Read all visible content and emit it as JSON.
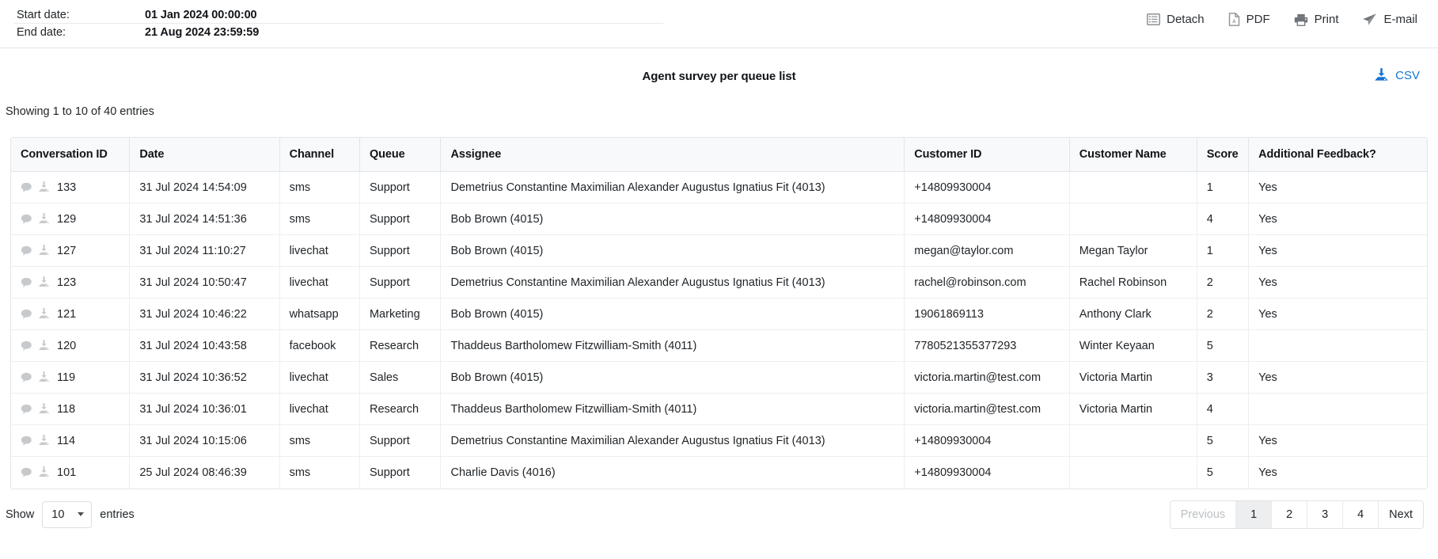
{
  "header": {
    "start_date_label": "Start date:",
    "start_date_value": "01 Jan 2024 00:00:00",
    "end_date_label": "End date:",
    "end_date_value": "21 Aug 2024 23:59:59",
    "toolbar": [
      {
        "label": "Detach",
        "icon": "detach-list-icon"
      },
      {
        "label": "PDF",
        "icon": "pdf-document-icon"
      },
      {
        "label": "Print",
        "icon": "printer-icon"
      },
      {
        "label": "E-mail",
        "icon": "paper-plane-icon"
      }
    ]
  },
  "report": {
    "title": "Agent survey per queue list",
    "csv_label": "CSV",
    "csv_icon": "download-icon",
    "csv_color": "#1574d4",
    "entries_info": "Showing 1 to 10 of 40 entries"
  },
  "table": {
    "row_icons": [
      "chat-bubble-icon",
      "download-icon"
    ],
    "columns": [
      "Conversation ID",
      "Date",
      "Channel",
      "Queue",
      "Assignee",
      "Customer ID",
      "Customer Name",
      "Score",
      "Additional Feedback?"
    ],
    "rows": [
      {
        "id": "133",
        "date": "31 Jul 2024 14:54:09",
        "channel": "sms",
        "queue": "Support",
        "assignee": "Demetrius Constantine Maximilian Alexander Augustus Ignatius Fit (4013)",
        "customer_id": "+14809930004",
        "customer_name": "",
        "score": "1",
        "feedback": "Yes"
      },
      {
        "id": "129",
        "date": "31 Jul 2024 14:51:36",
        "channel": "sms",
        "queue": "Support",
        "assignee": "Bob Brown (4015)",
        "customer_id": "+14809930004",
        "customer_name": "",
        "score": "4",
        "feedback": "Yes"
      },
      {
        "id": "127",
        "date": "31 Jul 2024 11:10:27",
        "channel": "livechat",
        "queue": "Support",
        "assignee": "Bob Brown (4015)",
        "customer_id": "megan@taylor.com",
        "customer_name": "Megan Taylor",
        "score": "1",
        "feedback": "Yes"
      },
      {
        "id": "123",
        "date": "31 Jul 2024 10:50:47",
        "channel": "livechat",
        "queue": "Support",
        "assignee": "Demetrius Constantine Maximilian Alexander Augustus Ignatius Fit (4013)",
        "customer_id": "rachel@robinson.com",
        "customer_name": "Rachel Robinson",
        "score": "2",
        "feedback": "Yes"
      },
      {
        "id": "121",
        "date": "31 Jul 2024 10:46:22",
        "channel": "whatsapp",
        "queue": "Marketing",
        "assignee": "Bob Brown (4015)",
        "customer_id": "19061869113",
        "customer_name": "Anthony Clark",
        "score": "2",
        "feedback": "Yes"
      },
      {
        "id": "120",
        "date": "31 Jul 2024 10:43:58",
        "channel": "facebook",
        "queue": "Research",
        "assignee": "Thaddeus Bartholomew Fitzwilliam-Smith (4011)",
        "customer_id": "7780521355377293",
        "customer_name": "Winter Keyaan",
        "score": "5",
        "feedback": ""
      },
      {
        "id": "119",
        "date": "31 Jul 2024 10:36:52",
        "channel": "livechat",
        "queue": "Sales",
        "assignee": "Bob Brown (4015)",
        "customer_id": "victoria.martin@test.com",
        "customer_name": "Victoria Martin",
        "score": "3",
        "feedback": "Yes"
      },
      {
        "id": "118",
        "date": "31 Jul 2024 10:36:01",
        "channel": "livechat",
        "queue": "Research",
        "assignee": "Thaddeus Bartholomew Fitzwilliam-Smith (4011)",
        "customer_id": "victoria.martin@test.com",
        "customer_name": "Victoria Martin",
        "score": "4",
        "feedback": ""
      },
      {
        "id": "114",
        "date": "31 Jul 2024 10:15:06",
        "channel": "sms",
        "queue": "Support",
        "assignee": "Demetrius Constantine Maximilian Alexander Augustus Ignatius Fit (4013)",
        "customer_id": "+14809930004",
        "customer_name": "",
        "score": "5",
        "feedback": "Yes"
      },
      {
        "id": "101",
        "date": "25 Jul 2024 08:46:39",
        "channel": "sms",
        "queue": "Support",
        "assignee": "Charlie Davis (4016)",
        "customer_id": "+14809930004",
        "customer_name": "",
        "score": "5",
        "feedback": "Yes"
      }
    ]
  },
  "footer": {
    "show_label": "Show",
    "entries_label": "entries",
    "page_size": "10",
    "pagination": {
      "previous_label": "Previous",
      "next_label": "Next",
      "pages": [
        "1",
        "2",
        "3",
        "4"
      ],
      "active_page": "1"
    }
  }
}
